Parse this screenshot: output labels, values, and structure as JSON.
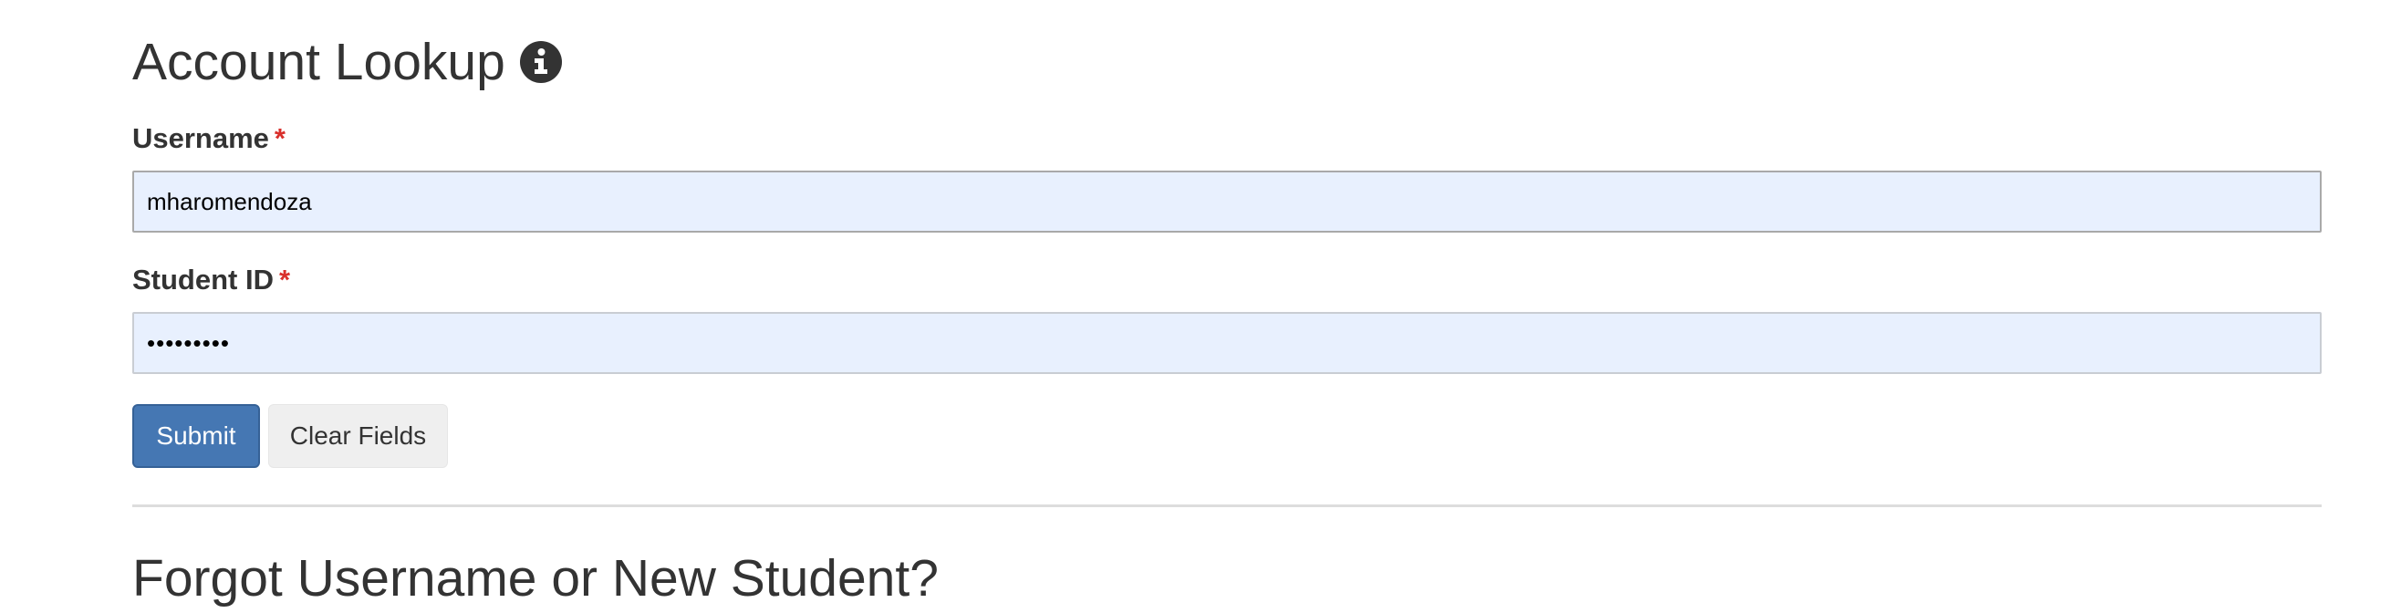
{
  "page": {
    "title": "Account Lookup",
    "title_icon": "info-circle-icon"
  },
  "form": {
    "username": {
      "label": "Username",
      "required_marker": "*",
      "value": "mharomendoza"
    },
    "student_id": {
      "label": "Student ID",
      "required_marker": "*",
      "value": "•••••••••"
    },
    "submit_label": "Submit",
    "clear_label": "Clear Fields"
  },
  "next_section": {
    "heading": "Forgot Username or New Student?"
  },
  "colors": {
    "primary_button": "#4577b3",
    "required_star": "#d9302c",
    "autofill_background": "#e8f0fe"
  }
}
